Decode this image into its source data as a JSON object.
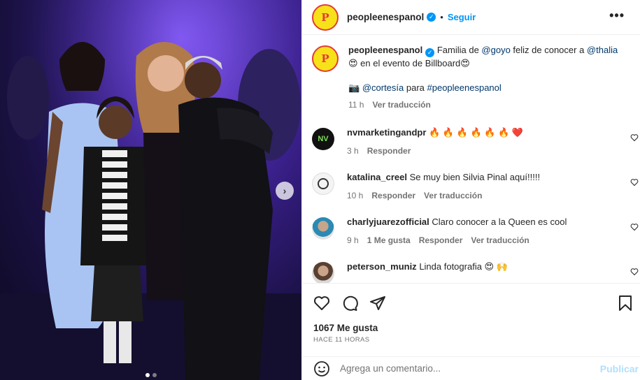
{
  "post": {
    "author": "peopleenespanol",
    "avatar_letter": "P",
    "follow_label": "Seguir",
    "more_label": "•••",
    "caption": {
      "username": "peopleenespanol",
      "text_1": "Familia de ",
      "mention_1": "@goyo",
      "text_2": " feliz de conocer a ",
      "mention_2": "@thalia",
      "line_2_emoji": "😍",
      "line_2_text": " en el evento de Billboard",
      "line_2_emoji_end": "😍",
      "credit_emoji": "📷",
      "credit_mention": "@cortesía",
      "credit_text": " para ",
      "credit_tag": "#peopleenespanol",
      "time": "11 h",
      "translate_label": "Ver traducción"
    },
    "comments": [
      {
        "username": "nvmarketingandpr",
        "text": "🔥 🔥 🔥 🔥 🔥 🔥 ❤️",
        "time": "3 h",
        "reply_label": "Responder",
        "avatar_text": "NV"
      },
      {
        "username": "katalina_creel",
        "text": "Se muy bien Silvia Pinal aquí!!!!!",
        "time": "10 h",
        "reply_label": "Responder",
        "translate_label": "Ver traducción"
      },
      {
        "username": "charlyjuarezofficial",
        "text": "Claro conocer a la Queen es cool",
        "time": "9 h",
        "likes_label": "1 Me gusta",
        "reply_label": "Responder",
        "translate_label": "Ver traducción"
      },
      {
        "username": "peterson_muniz",
        "text": "Linda fotografia 😍 🙌"
      }
    ],
    "likes_count": "1067 Me gusta",
    "time_ago": "HACE 11 HORAS",
    "comment_placeholder": "Agrega un comentario...",
    "publish_label": "Publicar",
    "next_arrow": "›",
    "carousel": {
      "slides": 2,
      "active": 0
    }
  },
  "colors": {
    "accent": "#0095f6",
    "publish_disabled": "#b2dffc",
    "muted": "#737373",
    "text": "#262626"
  }
}
